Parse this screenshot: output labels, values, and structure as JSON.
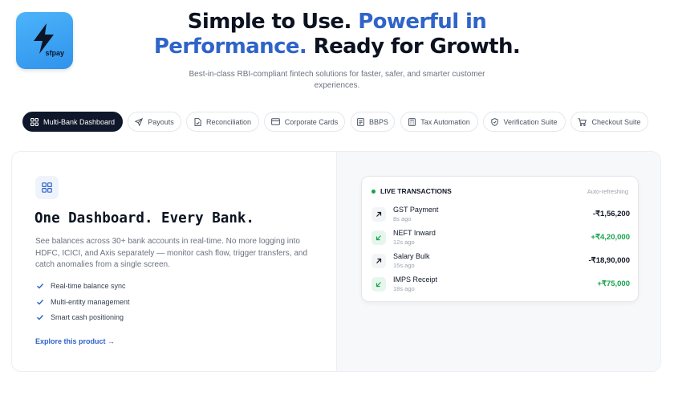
{
  "brand": {
    "logo_text": "sfpay"
  },
  "hero": {
    "title_part1": "Simple to Use. ",
    "title_accent": "Powerful in Performance.",
    "title_part2": " Ready for Growth.",
    "subtitle": "Best-in-class RBI-compliant fintech solutions for faster, safer, and smarter customer experiences."
  },
  "tabs": [
    {
      "label": "Multi-Bank Dashboard",
      "icon": "grid-icon",
      "active": true
    },
    {
      "label": "Payouts",
      "icon": "send-icon",
      "active": false
    },
    {
      "label": "Reconciliation",
      "icon": "document-check-icon",
      "active": false
    },
    {
      "label": "Corporate Cards",
      "icon": "card-icon",
      "active": false
    },
    {
      "label": "BBPS",
      "icon": "receipt-icon",
      "active": false
    },
    {
      "label": "Tax Automation",
      "icon": "calculator-icon",
      "active": false
    },
    {
      "label": "Verification Suite",
      "icon": "shield-icon",
      "active": false
    },
    {
      "label": "Checkout Suite",
      "icon": "cart-icon",
      "active": false
    }
  ],
  "feature": {
    "icon": "grid-icon",
    "title": "One Dashboard. Every Bank.",
    "description": "See balances across 30+ bank accounts in real-time. No more logging into HDFC, ICICI, and Axis separately — monitor cash flow, trigger transfers, and catch anomalies from a single screen.",
    "checks": [
      "Real-time balance sync",
      "Multi-entity management",
      "Smart cash positioning"
    ],
    "cta": "Explore this product →"
  },
  "transactions": {
    "header": "LIVE TRANSACTIONS",
    "status": "Auto-refreshing",
    "items": [
      {
        "name": "GST Payment",
        "time": "8s ago",
        "amount": "-₹1,56,200",
        "direction": "out"
      },
      {
        "name": "NEFT Inward",
        "time": "12s ago",
        "amount": "+₹4,20,000",
        "direction": "in"
      },
      {
        "name": "Salary Bulk",
        "time": "15s ago",
        "amount": "-₹18,90,000",
        "direction": "out"
      },
      {
        "name": "IMPS Receipt",
        "time": "18s ago",
        "amount": "+₹75,000",
        "direction": "in"
      }
    ]
  },
  "colors": {
    "accent": "#2f64c9",
    "dark": "#0f172a",
    "positive": "#16a34a",
    "logo_bg": "#3ea3f4"
  }
}
